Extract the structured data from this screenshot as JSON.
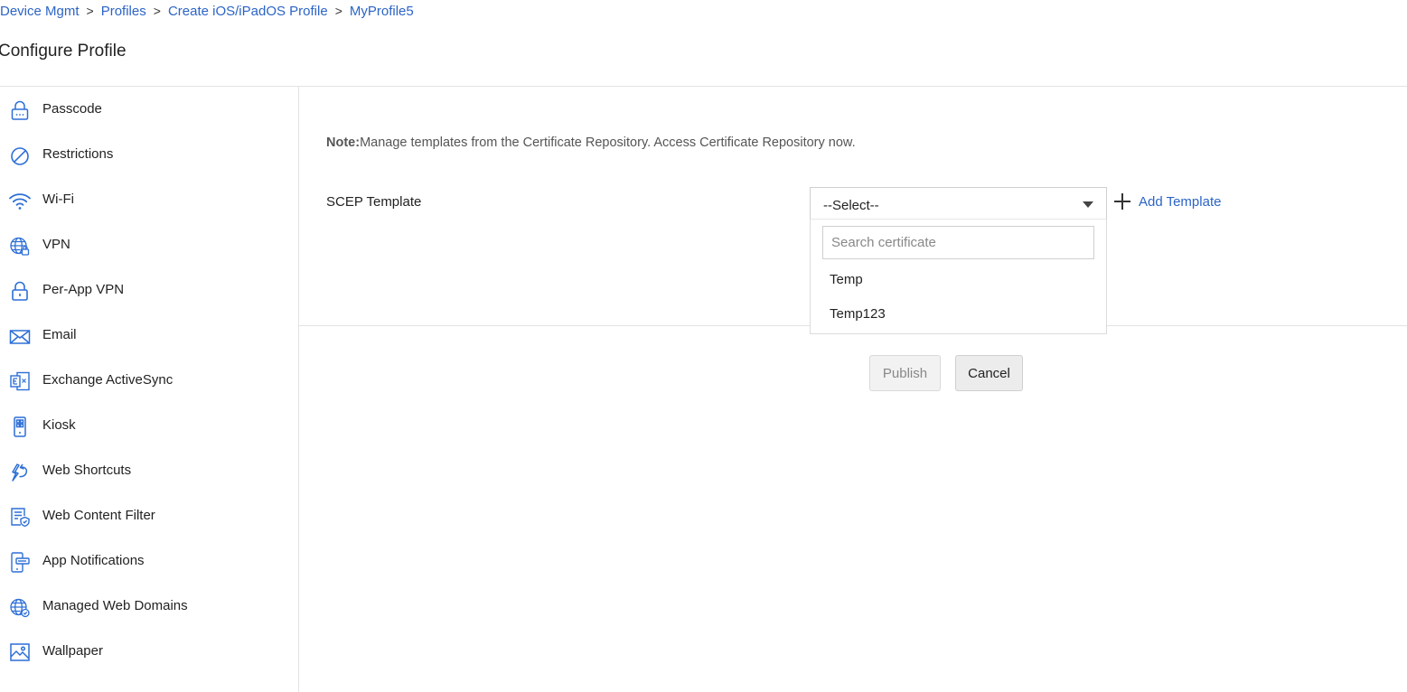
{
  "breadcrumb": {
    "items": [
      "Device Mgmt",
      "Profiles",
      "Create iOS/iPadOS Profile",
      "MyProfile5"
    ],
    "separator": ">"
  },
  "page_title": "Configure Profile",
  "sidebar": {
    "items": [
      {
        "label": "Passcode",
        "icon": "lock-icon"
      },
      {
        "label": "Restrictions",
        "icon": "prohibited-icon"
      },
      {
        "label": "Wi-Fi",
        "icon": "wifi-icon"
      },
      {
        "label": "VPN",
        "icon": "globe-lock-icon"
      },
      {
        "label": "Per-App VPN",
        "icon": "padlock-icon"
      },
      {
        "label": "Email",
        "icon": "envelope-icon"
      },
      {
        "label": "Exchange ActiveSync",
        "icon": "exchange-icon"
      },
      {
        "label": "Kiosk",
        "icon": "kiosk-icon"
      },
      {
        "label": "Web Shortcuts",
        "icon": "shortcut-icon"
      },
      {
        "label": "Web Content Filter",
        "icon": "content-filter-icon"
      },
      {
        "label": "App Notifications",
        "icon": "phone-notification-icon"
      },
      {
        "label": "Managed Web Domains",
        "icon": "globe-check-icon"
      },
      {
        "label": "Wallpaper",
        "icon": "image-icon"
      }
    ]
  },
  "main": {
    "note_label": "Note:",
    "note_text": "Manage templates from the Certificate Repository. Access Certificate Repository now.",
    "scep_label": "SCEP Template",
    "select_value": "--Select--",
    "add_template_label": "Add Template",
    "dropdown": {
      "search_placeholder": "Search certificate",
      "options": [
        "Temp",
        "Temp123"
      ]
    },
    "publish_label": "Publish",
    "cancel_label": "Cancel"
  },
  "colors": {
    "accent": "#2c64c6",
    "icon": "#2d6fd6",
    "divider": "#e3e3e3"
  }
}
